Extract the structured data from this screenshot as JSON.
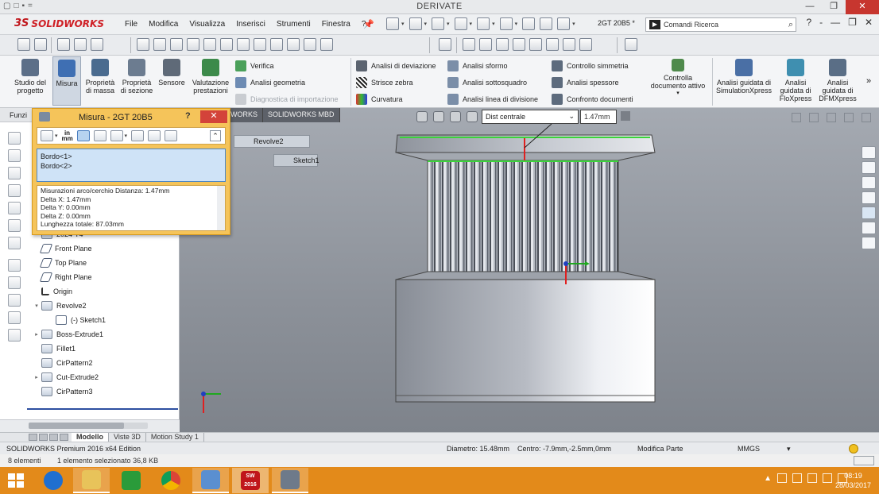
{
  "window": {
    "document_title": "DERIVATE",
    "quick_access": [
      "▢",
      "□",
      "▪",
      "="
    ],
    "controls": {
      "minimize": "—",
      "restore": "❐",
      "close": "✕"
    }
  },
  "app": {
    "logo_prefix": "3S",
    "logo_name": "SOLIDWORKS"
  },
  "menu": [
    "File",
    "Modifica",
    "Visualizza",
    "Inserisci",
    "Strumenti",
    "Finestra",
    "?"
  ],
  "config_name": "2GT 20B5 *",
  "search": {
    "placeholder": "Comandi Ricerca",
    "icon": "command-icon"
  },
  "help_controls": [
    "?",
    "-",
    "—",
    "❐",
    "✕"
  ],
  "ribbon": {
    "big": [
      {
        "label": "Studio del progetto",
        "icon": "design-study-icon"
      },
      {
        "label": "Misura",
        "icon": "measure-icon",
        "active": true
      },
      {
        "label": "Proprietà di massa",
        "icon": "mass-properties-icon"
      },
      {
        "label": "Proprietà di sezione",
        "icon": "section-properties-icon"
      },
      {
        "label": "Sensore",
        "icon": "sensor-icon"
      },
      {
        "label": "Valutazione prestazioni",
        "icon": "performance-icon"
      }
    ],
    "col1": [
      {
        "label": "Verifica",
        "icon": "check-icon",
        "dim": false
      },
      {
        "label": "Analisi geometria",
        "icon": "geometry-analysis-icon",
        "dim": false
      },
      {
        "label": "Diagnostica di importazione",
        "icon": "import-diagnostics-icon",
        "dim": true
      }
    ],
    "col2": [
      {
        "label": "Analisi di deviazione",
        "icon": "deviation-icon"
      },
      {
        "label": "Strisce zebra",
        "icon": "zebra-icon"
      },
      {
        "label": "Curvatura",
        "icon": "curvature-icon"
      }
    ],
    "col3": [
      {
        "label": "Analisi sformo",
        "icon": "draft-icon"
      },
      {
        "label": "Analisi sottosquadro",
        "icon": "undercut-icon"
      },
      {
        "label": "Analisi linea di divisione",
        "icon": "parting-line-icon"
      }
    ],
    "col4": [
      {
        "label": "Controllo simmetria",
        "icon": "symmetry-icon"
      },
      {
        "label": "Analisi spessore",
        "icon": "thickness-icon"
      },
      {
        "label": "Confronto documenti",
        "icon": "compare-icon"
      }
    ],
    "active_doc_check": "Controlla documento attivo",
    "xpress": [
      {
        "label": "Analisi guidata di SimulationXpress",
        "icon": "simxpress-icon"
      },
      {
        "label": "Analisi guidata di FloXpress",
        "icon": "floxpress-icon"
      },
      {
        "label": "Analisi guidata di DFMXpress",
        "icon": "dfmxpress-icon"
      }
    ],
    "more": "»"
  },
  "fm": {
    "tab_label": "Funzi",
    "tree": [
      {
        "label": "2024-T4",
        "icon": "material-icon",
        "exp": ""
      },
      {
        "label": "Front Plane",
        "icon": "plane-icon",
        "exp": ""
      },
      {
        "label": "Top Plane",
        "icon": "plane-icon",
        "exp": ""
      },
      {
        "label": "Right Plane",
        "icon": "plane-icon",
        "exp": ""
      },
      {
        "label": "Origin",
        "icon": "origin-icon",
        "exp": ""
      },
      {
        "label": "Revolve2",
        "icon": "revolve-icon",
        "exp": "▾"
      },
      {
        "label": "(-) Sketch1",
        "icon": "sketch-icon",
        "exp": "",
        "indent": true
      },
      {
        "label": "Boss-Extrude1",
        "icon": "extrude-icon",
        "exp": "▸"
      },
      {
        "label": "Fillet1",
        "icon": "fillet-icon",
        "exp": ""
      },
      {
        "label": "CirPattern2",
        "icon": "pattern-icon",
        "exp": ""
      },
      {
        "label": "Cut-Extrude2",
        "icon": "cut-icon",
        "exp": "▸"
      },
      {
        "label": "CirPattern3",
        "icon": "pattern-icon",
        "exp": ""
      }
    ]
  },
  "measure": {
    "title": "Misura - 2GT 20B5",
    "help": "?",
    "close": "✕",
    "units_top": "in",
    "units_bottom": "mm",
    "collapse": "⌃",
    "selections": [
      "Bordo<1>",
      "Bordo<2>"
    ],
    "results": [
      "Misurazioni arco/cerchio Distanza: 1.47mm",
      "Delta X: 1.47mm",
      "Delta Y: 0.00mm",
      "Delta Z: 0.00mm",
      "Lunghezza totale: 87.03mm"
    ]
  },
  "graphics": {
    "tabs": [
      "WORKS",
      "SOLIDWORKS MBD"
    ],
    "dist_mode": "Dist centrale",
    "dist_value": "1.47mm",
    "flyout": [
      "Revolve2",
      "Sketch1"
    ]
  },
  "bottom_tabs": [
    "Modello",
    "Viste 3D",
    "Motion Study 1"
  ],
  "status": {
    "edition": "SOLIDWORKS Premium 2016 x64 Edition",
    "diameter": "Diametro: 15.48mm",
    "center": "Centro: -7.9mm,-2.5mm,0mm",
    "mode": "Modifica Parte",
    "units": "MMGS"
  },
  "explorer": {
    "items": "8 elementi",
    "selected": "1 elemento selezionato 36,8 KB"
  },
  "taskbar": {
    "apps": [
      {
        "name": "ie-icon",
        "color": "#1f6fd0"
      },
      {
        "name": "file-explorer-icon",
        "color": "#e8c35a"
      },
      {
        "name": "store-icon",
        "color": "#2a9b3a"
      },
      {
        "name": "chrome-icon",
        "color": "#db4437"
      },
      {
        "name": "photos-icon",
        "color": "#5a8fd0"
      },
      {
        "name": "solidworks-icon",
        "color": "#c0161b",
        "label": "SW 2016"
      },
      {
        "name": "calculator-icon",
        "color": "#6e7a8a"
      }
    ],
    "time": "08:19",
    "date": "28/03/2017"
  }
}
